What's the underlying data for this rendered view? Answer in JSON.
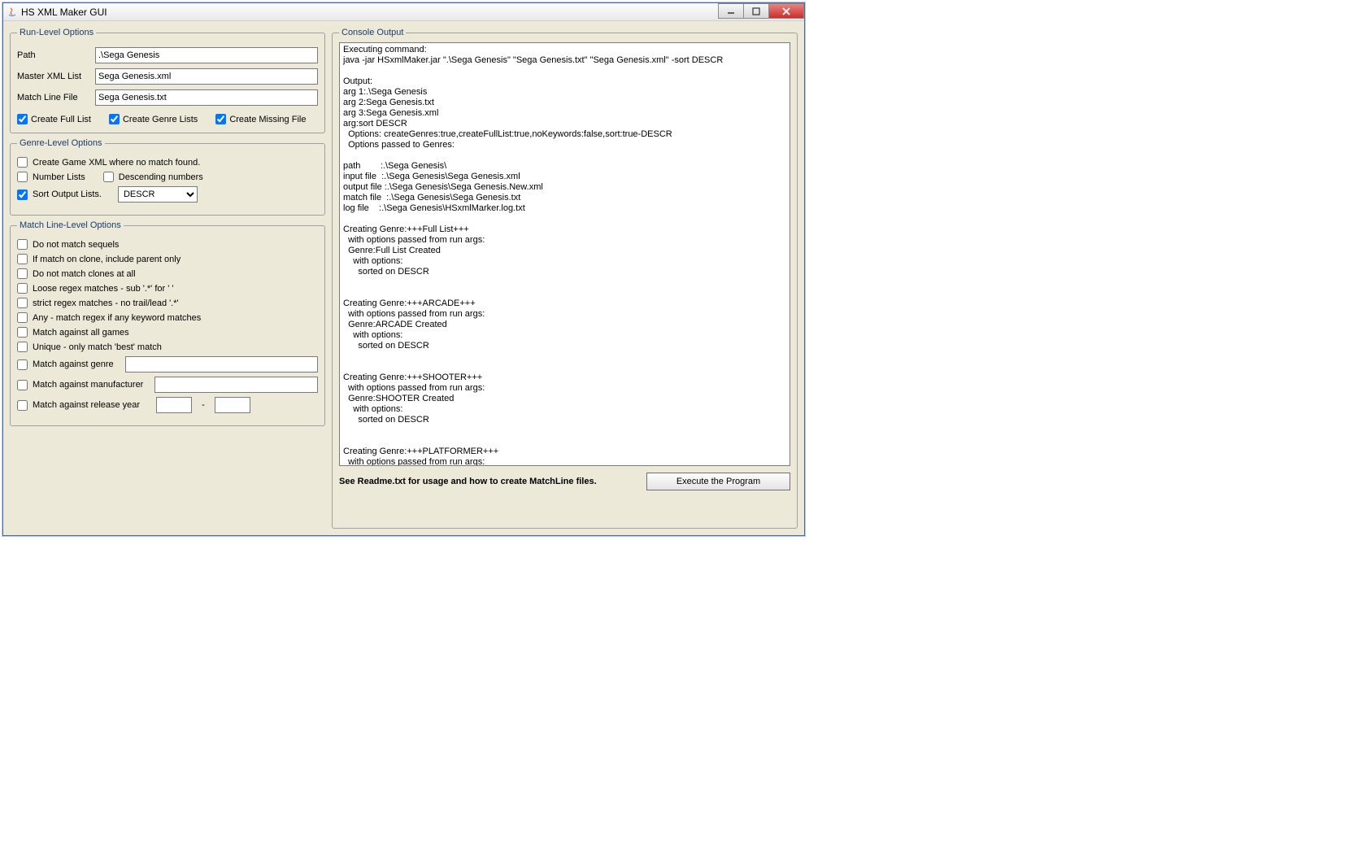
{
  "window": {
    "title": "HS XML Maker GUI"
  },
  "runLevel": {
    "legend": "Run-Level Options",
    "pathLabel": "Path",
    "pathValue": ".\\Sega Genesis",
    "masterLabel": "Master XML List",
    "masterValue": "Sega Genesis.xml",
    "matchLabel": "Match Line File",
    "matchValue": "Sega Genesis.txt",
    "createFull": "Create Full List",
    "createGenre": "Create Genre Lists",
    "createMissing": "Create Missing File"
  },
  "genreLevel": {
    "legend": "Genre-Level Options",
    "createGameXml": "Create Game XML where no match found.",
    "numberLists": "Number Lists",
    "descending": "Descending numbers",
    "sortOutput": "Sort Output Lists.",
    "sortValue": "DESCR"
  },
  "matchLevel": {
    "legend": "Match Line-Level Options",
    "noSequels": "Do not match sequels",
    "cloneParent": "If match on clone, include parent only",
    "noClones": "Do not match clones at all",
    "looseRegex": "Loose regex matches - sub '.*' for ' '",
    "strictRegex": "strict regex matches - no trail/lead '.*'",
    "anyKeyword": "Any - match regex if any keyword matches",
    "allGames": "Match against all games",
    "uniqueBest": "Unique - only match 'best' match",
    "matchGenre": "Match against genre",
    "matchManuf": "Match against manufacturer",
    "matchYear": "Match against release year"
  },
  "console": {
    "legend": "Console Output",
    "text": "Executing command:\njava -jar HSxmlMaker.jar \".\\Sega Genesis\" \"Sega Genesis.txt\" \"Sega Genesis.xml\" -sort DESCR\n\nOutput:\narg 1:.\\Sega Genesis\narg 2:Sega Genesis.txt\narg 3:Sega Genesis.xml\narg:sort DESCR\n  Options: createGenres:true,createFullList:true,noKeywords:false,sort:true-DESCR\n  Options passed to Genres:\n\npath        :.\\Sega Genesis\\\ninput file  :.\\Sega Genesis\\Sega Genesis.xml\noutput file :.\\Sega Genesis\\Sega Genesis.New.xml\nmatch file  :.\\Sega Genesis\\Sega Genesis.txt\nlog file    :.\\Sega Genesis\\HSxmlMarker.log.txt\n\nCreating Genre:+++Full List+++\n  with options passed from run args:\n  Genre:Full List Created\n    with options:\n      sorted on DESCR\n\n\nCreating Genre:+++ARCADE+++\n  with options passed from run args:\n  Genre:ARCADE Created\n    with options:\n      sorted on DESCR\n\n\nCreating Genre:+++SHOOTER+++\n  with options passed from run args:\n  Genre:SHOOTER Created\n    with options:\n      sorted on DESCR\n\n\nCreating Genre:+++PLATFORMER+++\n  with options passed from run args:"
  },
  "footer": {
    "readme": "See Readme.txt for usage and how to create MatchLine files.",
    "execute": "Execute the Program"
  }
}
